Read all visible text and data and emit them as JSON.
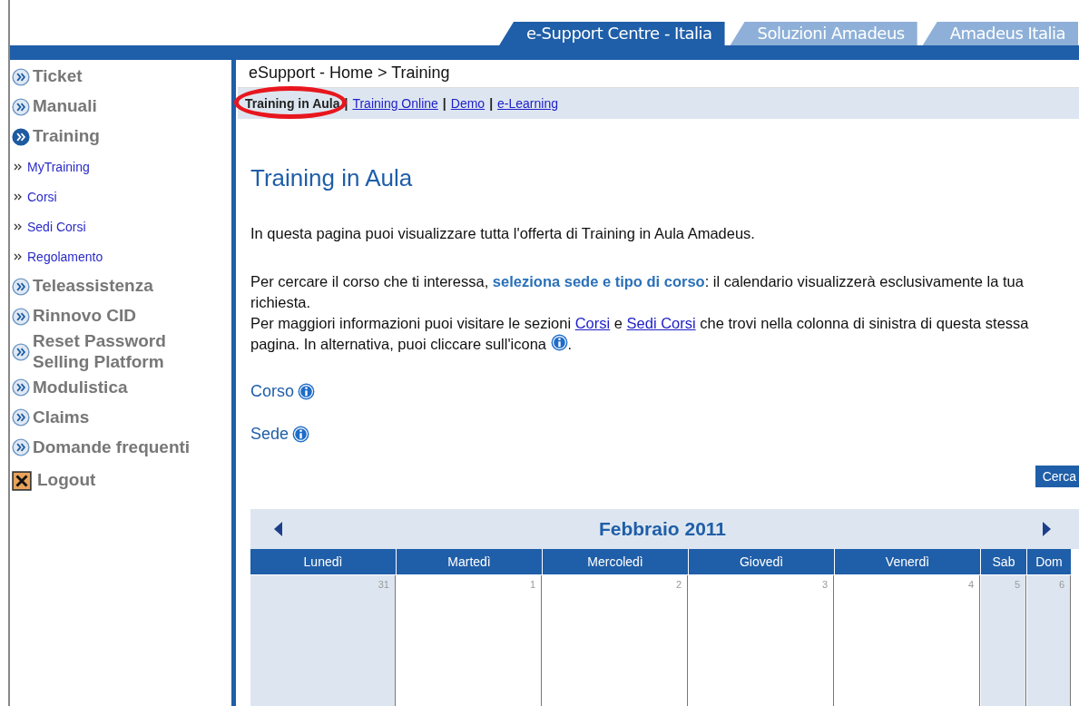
{
  "header_tabs": [
    {
      "label": "e-Support Centre - Italia",
      "selected": true
    },
    {
      "label": "Soluzioni Amadeus",
      "selected": false
    },
    {
      "label": "Amadeus Italia",
      "selected": false
    }
  ],
  "sidebar": {
    "items": [
      {
        "kind": "main",
        "label": "Ticket",
        "selected": false
      },
      {
        "kind": "main",
        "label": "Manuali",
        "selected": false
      },
      {
        "kind": "main",
        "label": "Training",
        "selected": true
      },
      {
        "kind": "sub",
        "label": "MyTraining"
      },
      {
        "kind": "sub",
        "label": "Corsi"
      },
      {
        "kind": "sub",
        "label": "Sedi Corsi"
      },
      {
        "kind": "sub",
        "label": "Regolamento"
      },
      {
        "kind": "main",
        "label": "Teleassistenza",
        "selected": false
      },
      {
        "kind": "main",
        "label": "Rinnovo CID",
        "selected": false
      },
      {
        "kind": "main",
        "label": "Reset Password Selling Platform",
        "selected": false
      },
      {
        "kind": "main",
        "label": "Modulistica",
        "selected": false
      },
      {
        "kind": "main",
        "label": "Claims",
        "selected": false
      },
      {
        "kind": "main",
        "label": "Domande frequenti",
        "selected": false
      },
      {
        "kind": "logout",
        "label": "Logout"
      }
    ]
  },
  "breadcrumb": "eSupport - Home > Training",
  "subnav": [
    {
      "label": "Training in Aula",
      "selected": true,
      "circled": true
    },
    {
      "separator": "|",
      "label": "Training Online",
      "selected": false,
      "circled": false
    },
    {
      "separator": "|",
      "label": "Demo",
      "selected": false,
      "circled": false
    },
    {
      "separator": "|",
      "label": "e-Learning",
      "selected": false,
      "circled": false
    }
  ],
  "title": "Training in Aula",
  "intro": "In questa pagina puoi visualizzare tutta l'offerta di Training in Aula Amadeus.",
  "instructions": {
    "before": "Per cercare il corso che ti interessa, ",
    "highlight": "seleziona sede e tipo di corso",
    "after": ": il calendario visualizzerà esclusivamente la tua richiesta."
  },
  "more_info": {
    "text_1": "Per maggiori informazioni puoi visitare le sezioni",
    "link_1": "Corsi",
    "text_2": "e",
    "link_2": "Sedi Corsi",
    "text_3": "che trovi nella colonna di sinistra di questa stessa pagina. In alternativa, puoi cliccare sull'icona",
    "text_4": "."
  },
  "filters": [
    {
      "label": "Corso"
    },
    {
      "label": "Sede"
    }
  ],
  "search_button": "Cerca",
  "calendar": {
    "month": "Febbraio 2011",
    "days": [
      {
        "name": "Lunedì",
        "date": "31",
        "kind": "shaded"
      },
      {
        "name": "Martedì",
        "date": "1",
        "kind": "plain"
      },
      {
        "name": "Mercoledì",
        "date": "2",
        "kind": "plain"
      },
      {
        "name": "Giovedì",
        "date": "3",
        "kind": "plain"
      },
      {
        "name": "Venerdì",
        "date": "4",
        "kind": "plain"
      },
      {
        "name": "Sab",
        "date": "5",
        "kind": "shaded"
      },
      {
        "name": "Dom",
        "date": "6",
        "kind": "shaded"
      }
    ]
  }
}
